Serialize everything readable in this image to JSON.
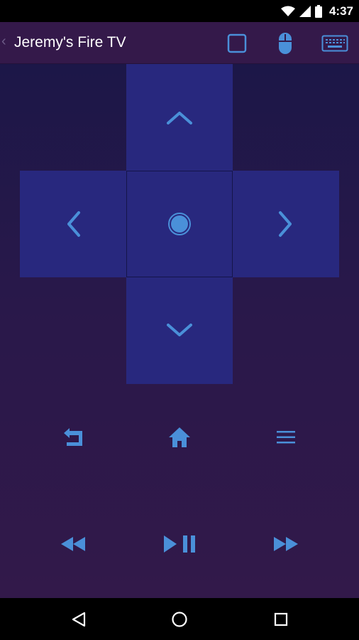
{
  "status_bar": {
    "time": "4:37"
  },
  "header": {
    "title": "Jeremy's Fire TV"
  },
  "colors": {
    "accent": "#4a90d9",
    "pad": "#28287e",
    "header_bg": "#34194a",
    "background": "#2e1a46"
  },
  "icons": {
    "back": "chevron-left-icon",
    "toolbar": [
      "square-icon",
      "mouse-icon",
      "keyboard-icon"
    ],
    "dpad": [
      "arrow-up-icon",
      "arrow-left-icon",
      "select-icon",
      "arrow-right-icon",
      "arrow-down-icon"
    ],
    "controls": [
      "back-return-icon",
      "home-icon",
      "menu-icon",
      "rewind-icon",
      "play-pause-icon",
      "fast-forward-icon"
    ],
    "navigation": [
      "nav-back-icon",
      "nav-home-icon",
      "nav-recents-icon"
    ]
  }
}
